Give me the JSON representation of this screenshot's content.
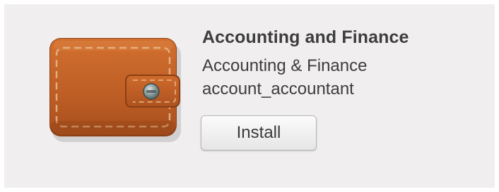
{
  "module": {
    "title": "Accounting and Finance",
    "summary": "Accounting & Finance",
    "technical_name": "account_accountant",
    "icon": "wallet-icon",
    "install_label": "Install"
  },
  "colors": {
    "card_background": "#f0eeef",
    "wallet_body": "#c0602a",
    "text": "#3d3d3d"
  }
}
